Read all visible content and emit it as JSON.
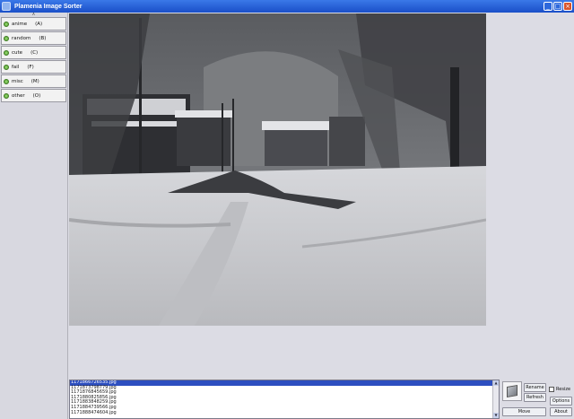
{
  "window": {
    "title": "Plamenia Image Sorter",
    "buttons": {
      "minimize": "_",
      "maximize": "□",
      "close": "×"
    }
  },
  "sidebar": {
    "collapse_glyph": "∧",
    "categories": [
      {
        "label": "anime",
        "key": "(A)"
      },
      {
        "label": "random",
        "key": "(B)"
      },
      {
        "label": "cute",
        "key": "(C)"
      },
      {
        "label": "fail",
        "key": "(F)"
      },
      {
        "label": "misc",
        "key": "(M)"
      },
      {
        "label": "other",
        "key": "(O)"
      }
    ]
  },
  "files": [
    "1171866726535.jpg",
    "1171873798779.jpg",
    "1171876845659.jpg",
    "1171880825856.jpg",
    "1171883848259.jpg",
    "1171884739566.jpg",
    "1171888474604.jpg"
  ],
  "selected_index": 0,
  "controls": {
    "rename": "Rename",
    "refresh": "Refresh",
    "resize": "Resize",
    "options": "Options",
    "move": "Move",
    "about": "About"
  }
}
